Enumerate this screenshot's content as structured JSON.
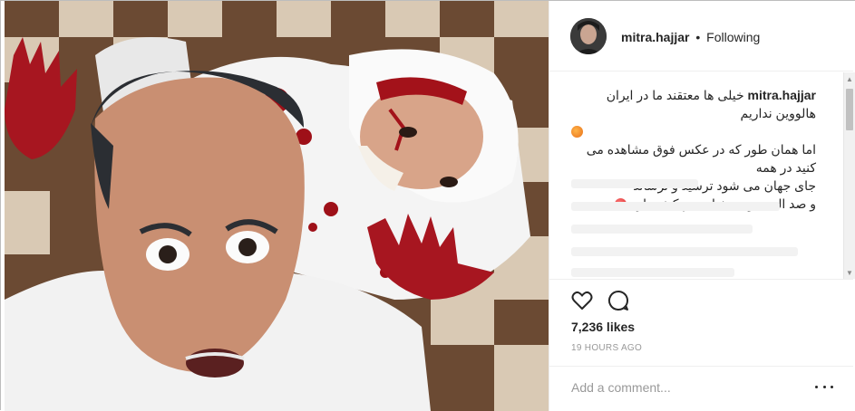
{
  "post": {
    "photo_description_icon": "photo-image",
    "author": {
      "username": "mitra.hajjar",
      "separator": "•",
      "follow_status": "Following"
    },
    "caption": {
      "username": "mitra.hajjar",
      "line1": "خیلی ها معتقند ما در ایران هالووین نداریم",
      "line2": "اما همان طور که در عکس فوق مشاهده می کنید در همه",
      "line3": "جای جهان می شود ترسید و ترساند",
      "line4": "و صد البته دومی خیلی هم کیف داره",
      "emoji1": "pumpkin-emoji",
      "emoji2": "devil-emoji"
    },
    "likes_text": "7,236 likes",
    "time_ago": "19 HOURS AGO",
    "comment_placeholder": "Add a comment...",
    "colors": {
      "text": "#262626",
      "muted": "#999999",
      "divider": "#efefef"
    }
  }
}
